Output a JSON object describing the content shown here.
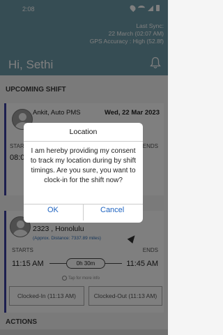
{
  "status_bar": {
    "time": "2:08"
  },
  "header": {
    "sync_label": "Last Sync:",
    "sync_time": "22 March (02:07 AM)",
    "gps": "GPS Accuracy : High (52.8f)",
    "greeting": "Hi, Sethi"
  },
  "upcoming": {
    "title": "UPCOMING SHIFT",
    "card1": {
      "name": "Ankit, Auto PMS",
      "date": "Wed, 22 Mar 2023",
      "starts_partial": "START",
      "ends_partial": "ENDS",
      "start_partial": "08:0"
    },
    "card2": {
      "location": "2323 , Honolulu",
      "distance": "(Approx. Distance: 7337.89 miles)",
      "starts_label": "STARTS",
      "ends_label": "ENDS",
      "start_time": "11:15 AM",
      "end_time": "11:45 AM",
      "duration": "0h 30m",
      "tap_info": "Tap for more info",
      "clocked_in": "Clocked-In (11:13 AM)",
      "clocked_out": "Clocked-Out (11:13 AM)"
    }
  },
  "actions_title": "ACTIONS",
  "dialog": {
    "title": "Location",
    "message": "I am hereby providing my consent to track my location during by shift timings. Are you sure, you want to clock-in for the shift now?",
    "ok": "OK",
    "cancel": "Cancel"
  }
}
